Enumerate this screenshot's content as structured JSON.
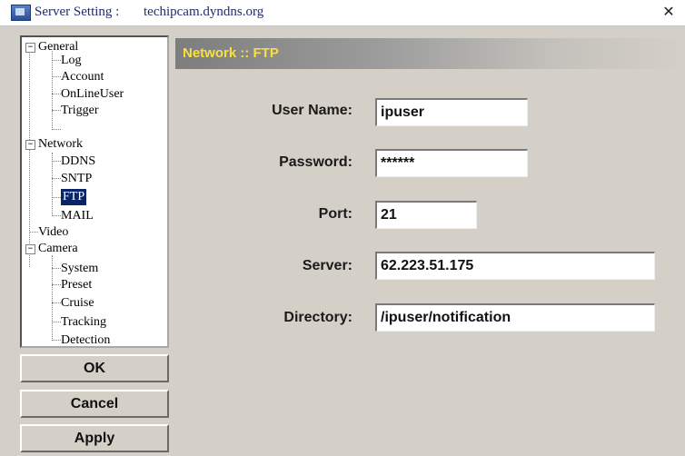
{
  "window": {
    "title_label": "Server Setting :",
    "title_host": "techipcam.dyndns.org",
    "close_glyph": "✕",
    "icon": "app-window-icon"
  },
  "tree": {
    "expander_glyph": "−",
    "groups": [
      {
        "label": "General",
        "children": [
          "Log",
          "Account",
          "OnLineUser",
          "Trigger"
        ]
      },
      {
        "label": "Network",
        "children": [
          "DDNS",
          "SNTP",
          "FTP",
          "MAIL"
        ]
      },
      {
        "label": "Video",
        "children": []
      },
      {
        "label": "Camera",
        "children": [
          "System",
          "Preset",
          "Cruise",
          "Tracking",
          "Detection"
        ]
      }
    ],
    "selected": "FTP"
  },
  "buttons": {
    "ok": "OK",
    "cancel": "Cancel",
    "apply": "Apply"
  },
  "header": {
    "title": "Network :: FTP"
  },
  "form": {
    "username": {
      "label": "User Name:",
      "value": "ipuser"
    },
    "password": {
      "label": "Password:",
      "value": "******"
    },
    "port": {
      "label": "Port:",
      "value": "21"
    },
    "server": {
      "label": "Server:",
      "value": "62.223.51.175"
    },
    "directory": {
      "label": "Directory:",
      "value": "/ipuser/notification"
    }
  },
  "colors": {
    "background": "#d4d0c8",
    "header_text": "#f6e046",
    "selection": "#0a246a",
    "title_text": "#1f2d6a"
  }
}
